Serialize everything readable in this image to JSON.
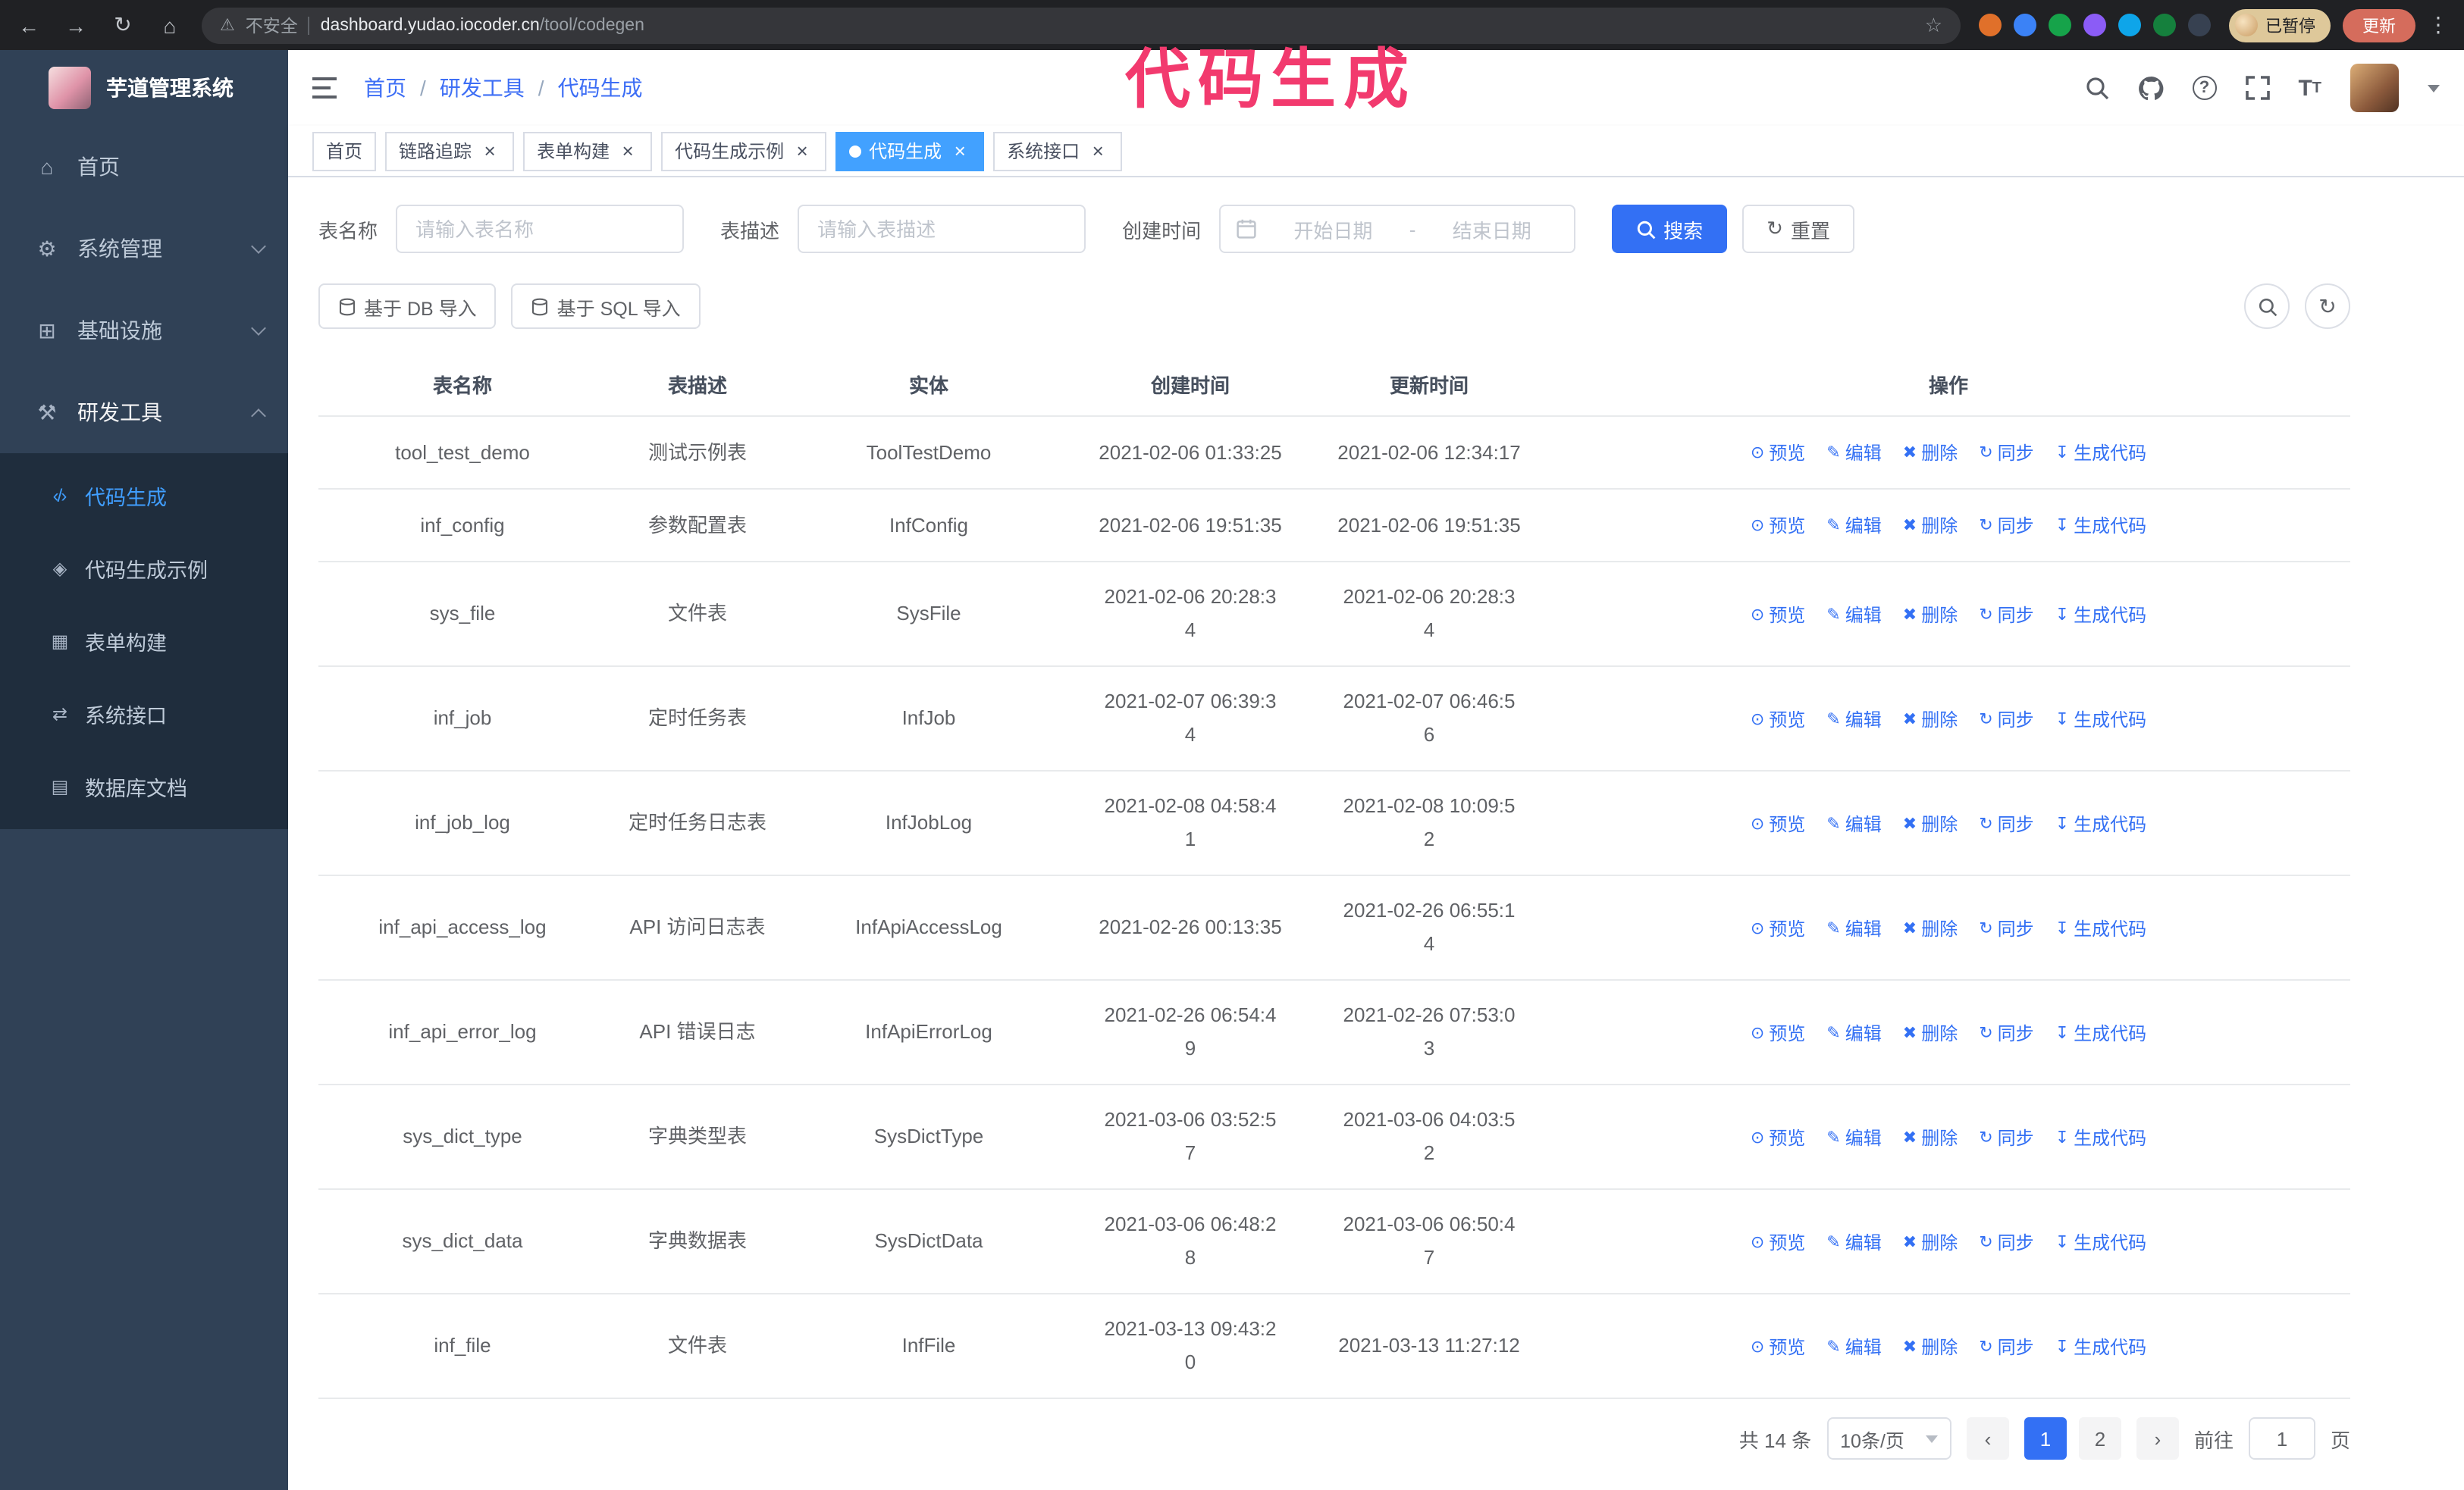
{
  "browser": {
    "security_label": "不安全",
    "url_host": "dashboard.yudao.iocoder.cn",
    "url_path": "/tool/codegen",
    "paused_badge": "已暂停",
    "update_button": "更新",
    "extension_colors": [
      "#e0702a",
      "#3b82f6",
      "#16a34a",
      "#8b5cf6",
      "#0ea5e9",
      "#15803d",
      "#374151"
    ]
  },
  "overlay": {
    "title": "代码生成",
    "color": "#f23a6e"
  },
  "sidebar": {
    "logo_text": "芋道管理系统",
    "items": [
      {
        "label": "首页",
        "name": "home",
        "icon": "⌂",
        "icon_name": "dashboard-icon"
      },
      {
        "label": "系统管理",
        "name": "system",
        "icon": "⚙",
        "icon_name": "gear-icon",
        "expandable": true
      },
      {
        "label": "基础设施",
        "name": "infrastructure",
        "icon": "⊞",
        "icon_name": "infrastructure-icon",
        "expandable": true
      },
      {
        "label": "研发工具",
        "name": "devtools",
        "icon": "⚒",
        "icon_name": "tools-icon",
        "expanded": true
      }
    ],
    "subitems": [
      {
        "label": "代码生成",
        "name": "codegen",
        "icon": "‹/›",
        "icon_name": "code-icon",
        "active": true
      },
      {
        "label": "代码生成示例",
        "name": "codegen-example",
        "icon": "◈",
        "icon_name": "badge-icon"
      },
      {
        "label": "表单构建",
        "name": "form-builder",
        "icon": "▦",
        "icon_name": "form-icon"
      },
      {
        "label": "系统接口",
        "name": "api",
        "icon": "⇄",
        "icon_name": "api-icon"
      },
      {
        "label": "数据库文档",
        "name": "db-doc",
        "icon": "▤",
        "icon_name": "database-doc-icon"
      }
    ]
  },
  "header": {
    "breadcrumb": [
      "首页",
      "研发工具",
      "代码生成"
    ]
  },
  "tabs": [
    {
      "label": "首页",
      "name": "home",
      "closable": false,
      "active": false
    },
    {
      "label": "链路追踪",
      "name": "tracing",
      "closable": true,
      "active": false
    },
    {
      "label": "表单构建",
      "name": "form-builder",
      "closable": true,
      "active": false
    },
    {
      "label": "代码生成示例",
      "name": "codegen-example",
      "closable": true,
      "active": false
    },
    {
      "label": "代码生成",
      "name": "codegen",
      "closable": true,
      "active": true
    },
    {
      "label": "系统接口",
      "name": "api",
      "closable": true,
      "active": false
    }
  ],
  "filters": {
    "table_name_label": "表名称",
    "table_name_placeholder": "请输入表名称",
    "table_desc_label": "表描述",
    "table_desc_placeholder": "请输入表描述",
    "create_time_label": "创建时间",
    "date_start_placeholder": "开始日期",
    "date_separator": "-",
    "date_end_placeholder": "结束日期",
    "search_button": "搜索",
    "reset_button": "重置"
  },
  "toolbar": {
    "import_db": "基于 DB 导入",
    "import_sql": "基于 SQL 导入"
  },
  "table": {
    "columns": [
      "表名称",
      "表描述",
      "实体",
      "创建时间",
      "更新时间",
      "操作"
    ],
    "row_actions": [
      {
        "label": "预览",
        "name": "preview",
        "icon": "⊙"
      },
      {
        "label": "编辑",
        "name": "edit",
        "icon": "✎"
      },
      {
        "label": "删除",
        "name": "delete",
        "icon": "✖"
      },
      {
        "label": "同步",
        "name": "sync",
        "icon": "↻"
      },
      {
        "label": "生成代码",
        "name": "generate-code",
        "icon": "↧"
      }
    ],
    "rows": [
      {
        "name": "tool_test_demo",
        "desc": "测试示例表",
        "entity": "ToolTestDemo",
        "created": "2021-02-06 01:33:25",
        "updated": "2021-02-06 12:34:17"
      },
      {
        "name": "inf_config",
        "desc": "参数配置表",
        "entity": "InfConfig",
        "created": "2021-02-06 19:51:35",
        "updated": "2021-02-06 19:51:35"
      },
      {
        "name": "sys_file",
        "desc": "文件表",
        "entity": "SysFile",
        "created": "2021-02-06 20:28:3\n4",
        "updated": "2021-02-06 20:28:3\n4"
      },
      {
        "name": "inf_job",
        "desc": "定时任务表",
        "entity": "InfJob",
        "created": "2021-02-07 06:39:3\n4",
        "updated": "2021-02-07 06:46:5\n6"
      },
      {
        "name": "inf_job_log",
        "desc": "定时任务日志表",
        "entity": "InfJobLog",
        "created": "2021-02-08 04:58:4\n1",
        "updated": "2021-02-08 10:09:5\n2"
      },
      {
        "name": "inf_api_access_log",
        "desc": "API 访问日志表",
        "entity": "InfApiAccessLog",
        "created": "2021-02-26 00:13:35",
        "updated": "2021-02-26 06:55:1\n4"
      },
      {
        "name": "inf_api_error_log",
        "desc": "API 错误日志",
        "entity": "InfApiErrorLog",
        "created": "2021-02-26 06:54:4\n9",
        "updated": "2021-02-26 07:53:0\n3"
      },
      {
        "name": "sys_dict_type",
        "desc": "字典类型表",
        "entity": "SysDictType",
        "created": "2021-03-06 03:52:5\n7",
        "updated": "2021-03-06 04:03:5\n2"
      },
      {
        "name": "sys_dict_data",
        "desc": "字典数据表",
        "entity": "SysDictData",
        "created": "2021-03-06 06:48:2\n8",
        "updated": "2021-03-06 06:50:4\n7"
      },
      {
        "name": "inf_file",
        "desc": "文件表",
        "entity": "InfFile",
        "created": "2021-03-13 09:43:2\n0",
        "updated": "2021-03-13 11:27:12"
      }
    ]
  },
  "pagination": {
    "total_text": "共 14 条",
    "page_size": "10条/页",
    "prev_icon": "‹",
    "next_icon": "›",
    "pages": [
      "1",
      "2"
    ],
    "active_page": "1",
    "goto_label": "前往",
    "goto_value": "1",
    "goto_suffix": "页"
  },
  "colors": {
    "primary": "#3370f4",
    "active_tab": "#42a1ff",
    "sidebar_bg": "#304156",
    "submenu_bg": "#1f2d3d",
    "overlay_pink": "#f23a6e",
    "update_red": "#d56c5c",
    "paused_tan": "#dec89a"
  }
}
